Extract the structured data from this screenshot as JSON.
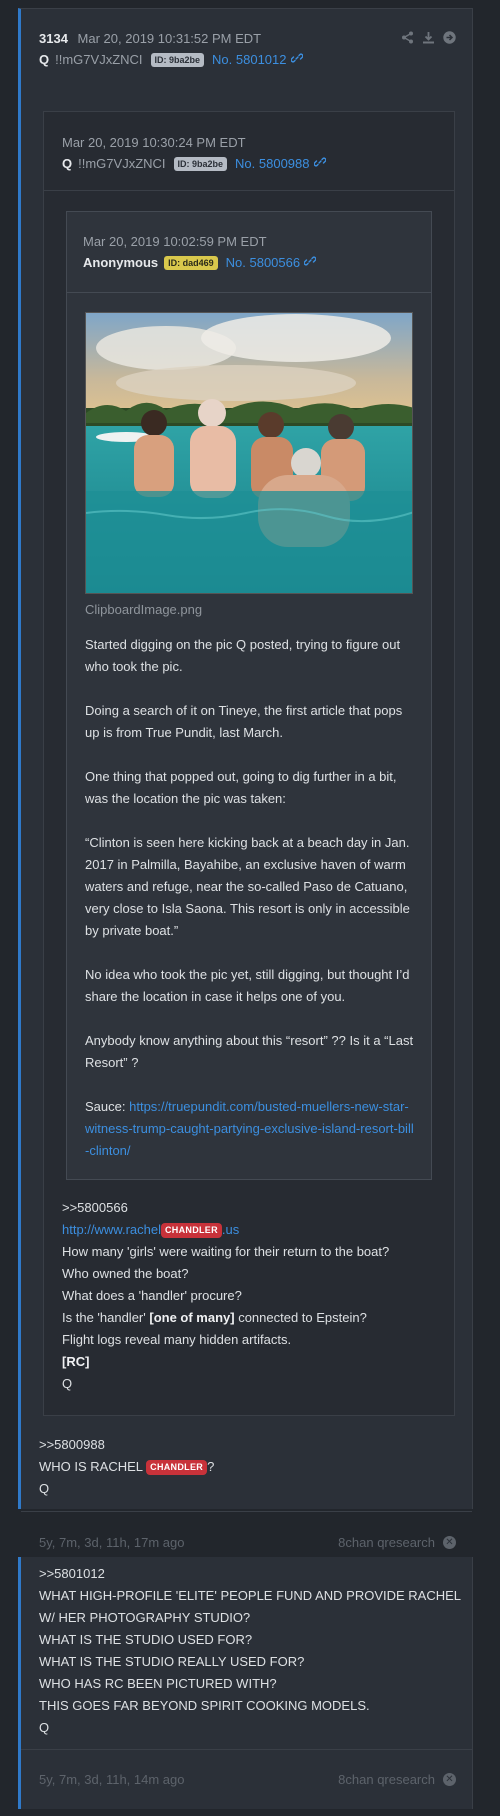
{
  "post1": {
    "number": "3134",
    "date": "Mar 20, 2019 10:31:52 PM EDT",
    "name": "Q",
    "tripcode": "!!mG7VJxZNCI",
    "id_badge": "ID: 9ba2be",
    "post_no": "No. 5801012",
    "toolbar_icons": [
      "share-icon",
      "download-icon",
      "arrow-right-icon"
    ],
    "quote": {
      "date": "Mar 20, 2019 10:30:24 PM EDT",
      "name": "Q",
      "tripcode": "!!mG7VJxZNCI",
      "id_badge": "ID: 9ba2be",
      "post_no": "No. 5800988",
      "quote": {
        "date": "Mar 20, 2019 10:02:59 PM EDT",
        "name": "Anonymous",
        "id_badge": "ID: dad469",
        "post_no": "No. 5800566",
        "image_caption": "ClipboardImage.png",
        "paragraphs": [
          "Started digging on the pic Q posted, trying to figure out who took the pic.",
          "Doing a search of it on Tineye, the first article that pops up is from True Pundit, last March.",
          "One thing that popped out, going to dig further in a bit, was the location the pic was taken:",
          "“Clinton is seen here kicking back at a beach day in Jan. 2017 in Palmilla, Bayahibe, an exclusive haven of warm waters and refuge, near the so-called Paso de Catuano, very close to Isla Saona. This resort is only in accessible by private boat.”",
          "No idea who took the pic yet, still digging, but thought I’d share the location in case it helps one of you.",
          "Anybody know anything about this “resort” ?? Is it a “Last Resort” ?"
        ],
        "sauce_label": "Sauce:",
        "sauce_link": "https://truepundit.com/busted-muellers-new-star-witness-trump-caught-partying-exclusive-island-resort-bill-clinton/"
      },
      "reply_ref": ">>5800566",
      "link_prefix": "http://www.rachel",
      "link_tag": "CHANDLER",
      "link_suffix": ".us",
      "lines": [
        "How many 'girls' were waiting for their return to the boat?",
        "Who owned the boat?",
        "What does a 'handler' procure?"
      ],
      "line_bold_pre": "Is the 'handler' ",
      "line_bold": "[one of many]",
      "line_bold_post": " connected to Epstein?",
      "line_flight": "Flight logs reveal many hidden artifacts.",
      "rc": "[RC]",
      "sig": "Q"
    },
    "reply_ref": ">>5800988",
    "who_prefix": "WHO IS RACHEL ",
    "who_tag": "CHANDLER",
    "who_suffix": "?",
    "sig": "Q",
    "footer_time": "5y, 7m, 3d, 11h, 17m ago",
    "footer_source": "8chan qresearch"
  },
  "post2": {
    "reply_ref": ">>5801012",
    "lines": [
      "WHAT HIGH-PROFILE 'ELITE' PEOPLE FUND AND PROVIDE RACHEL",
      "W/ HER PHOTOGRAPHY STUDIO?",
      "WHAT IS THE STUDIO USED FOR?",
      "WHAT IS THE STUDIO REALLY USED FOR?",
      "WHO HAS RC BEEN PICTURED WITH?",
      "THIS GOES FAR BEYOND SPIRIT COOKING MODELS."
    ],
    "sig": "Q",
    "footer_time": "5y, 7m, 3d, 11h, 14m ago",
    "footer_source": "8chan qresearch"
  }
}
